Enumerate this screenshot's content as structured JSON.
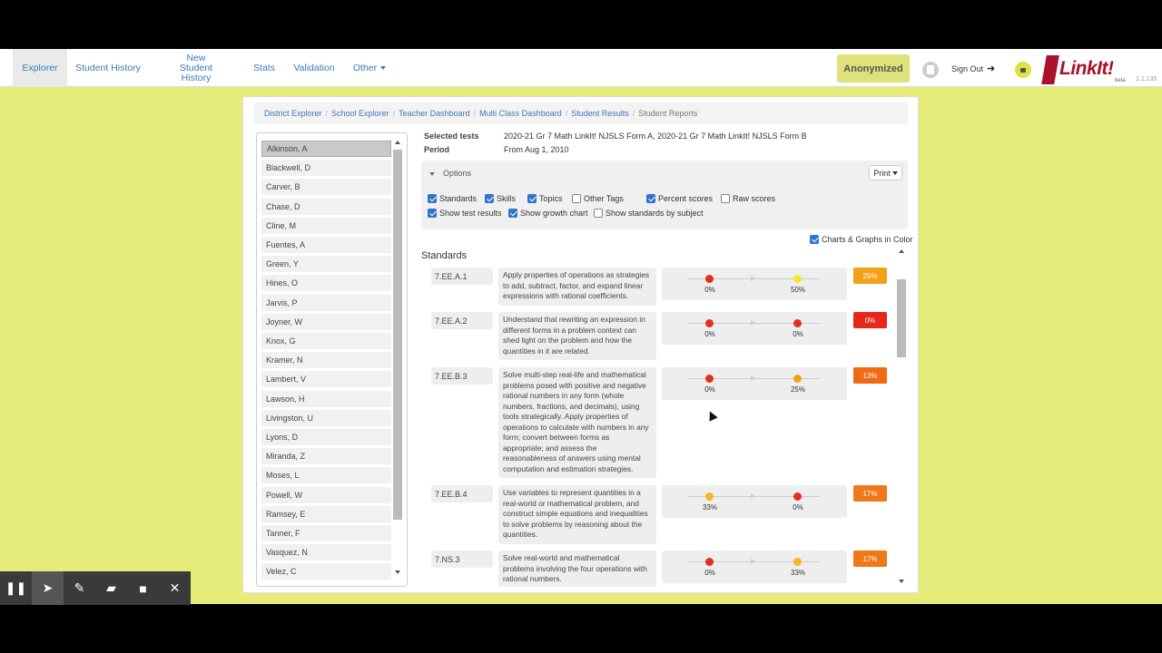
{
  "nav": {
    "items": [
      {
        "label": "Explorer",
        "active": true
      },
      {
        "label": "Student History"
      },
      {
        "label": "New Student History"
      },
      {
        "label": "Stats"
      },
      {
        "label": "Validation"
      },
      {
        "label": "Other"
      }
    ],
    "anonymized": "Anonymized",
    "sign_out": "Sign Out",
    "logo": "LinkIt!",
    "beta": "beta",
    "version": "1.1.135"
  },
  "breadcrumb": [
    "District Explorer",
    "School Explorer",
    "Teacher Dashboard",
    "Multi Class Dashboard",
    "Student Results",
    "Student Reports"
  ],
  "students": [
    "Alkinson, A",
    "Blackwell, D",
    "Carver, B",
    "Chase, D",
    "Cline, M",
    "Fuentes, A",
    "Green, Y",
    "Hines, O",
    "Jarvis, P",
    "Joyner, W",
    "Knox, G",
    "Kramer, N",
    "Lambert, V",
    "Lawson, H",
    "Livingston, U",
    "Lyons, D",
    "Miranda, Z",
    "Moses, L",
    "Powell, W",
    "Ramsey, E",
    "Tanner, F",
    "Vasquez, N",
    "Velez, C"
  ],
  "selected_student": "Alkinson, A",
  "report": {
    "selected_tests_label": "Selected tests",
    "selected_tests_value": "2020-21 Gr 7 Math LinkIt! NJSLS Form A, 2020-21 Gr 7 Math LinkIt! NJSLS Form B",
    "period_label": "Period",
    "period_value": "From Aug 1, 2010",
    "options_label": "Options",
    "print_label": "Print",
    "options": [
      {
        "label": "Standards",
        "checked": true
      },
      {
        "label": "Skills",
        "checked": true
      },
      {
        "label": "Topics",
        "checked": true
      },
      {
        "label": "Other Tags",
        "checked": false
      },
      {
        "label": "Percent scores",
        "checked": true
      },
      {
        "label": "Raw scores",
        "checked": false
      },
      {
        "label": "Show test results",
        "checked": true
      },
      {
        "label": "Show growth chart",
        "checked": true
      },
      {
        "label": "Show standards by subject",
        "checked": false
      }
    ],
    "color_option": {
      "label": "Charts & Graphs in Color",
      "checked": true
    },
    "standards_heading": "Standards"
  },
  "standards": [
    {
      "code": "7.EE.A.1",
      "description": "Apply properties of operations as strategies to add, subtract, factor, and expand linear expressions with rational coefficients.",
      "score_a": "0%",
      "score_b": "50%",
      "color_a": "#e03020",
      "color_b": "#f6e830",
      "overall": "25%",
      "overall_color": "#f4a01a"
    },
    {
      "code": "7.EE.A.2",
      "description": "Understand that rewriting an expression in different forms in a problem context can shed light on the problem and how the quantities in it are related.",
      "score_a": "0%",
      "score_b": "0%",
      "color_a": "#e03020",
      "color_b": "#e03020",
      "overall": "0%",
      "overall_color": "#e8261c"
    },
    {
      "code": "7.EE.B.3",
      "description": "Solve multi-step real-life and mathematical problems posed with positive and negative rational numbers in any form (whole numbers, fractions, and decimals), using tools strategically. Apply properties of operations to calculate with numbers in any form; convert between forms as appropriate; and assess the reasonableness of answers using mental computation and estimation strategies.",
      "score_a": "0%",
      "score_b": "25%",
      "color_a": "#e03020",
      "color_b": "#f4a01a",
      "overall": "13%",
      "overall_color": "#ef6a14"
    },
    {
      "code": "7.EE.B.4",
      "description": "Use variables to represent quantities in a real-world or mathematical problem, and construct simple equations and inequalities to solve problems by reasoning about the quantities.",
      "score_a": "33%",
      "score_b": "0%",
      "color_a": "#f4b820",
      "color_b": "#e03020",
      "overall": "17%",
      "overall_color": "#ef7818"
    },
    {
      "code": "7.NS.3",
      "description": "Solve real-world and mathematical problems involving the four operations with rational numbers.",
      "score_a": "0%",
      "score_b": "33%",
      "color_a": "#e03020",
      "color_b": "#f4b820",
      "overall": "17%",
      "overall_color": "#ef7818"
    }
  ],
  "toolbar": [
    "pause-icon",
    "pointer-icon",
    "pen-icon",
    "highlighter-icon",
    "camera-icon",
    "close-icon"
  ]
}
